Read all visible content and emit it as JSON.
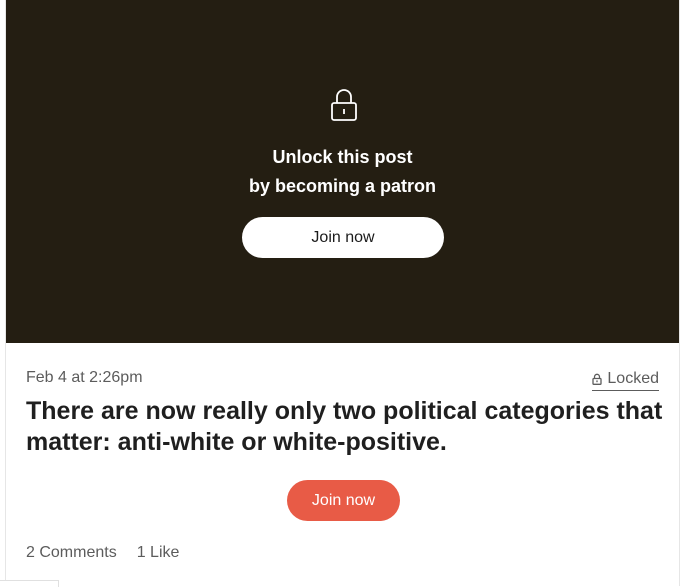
{
  "locked_banner": {
    "background_color": "#241e12",
    "icon": "padlock-icon",
    "line1": "Unlock this post",
    "line2": "by becoming a patron",
    "join_label": "Join now"
  },
  "post": {
    "date": "Feb 4 at 2:26pm",
    "locked_icon": "lock-icon",
    "locked_label": "Locked",
    "title": "There are now really only two political categories that matter: anti-white or white-positive.",
    "join_label": "Join now",
    "join_color": "#e85b46",
    "comments": "2 Comments",
    "likes": "1 Like"
  }
}
